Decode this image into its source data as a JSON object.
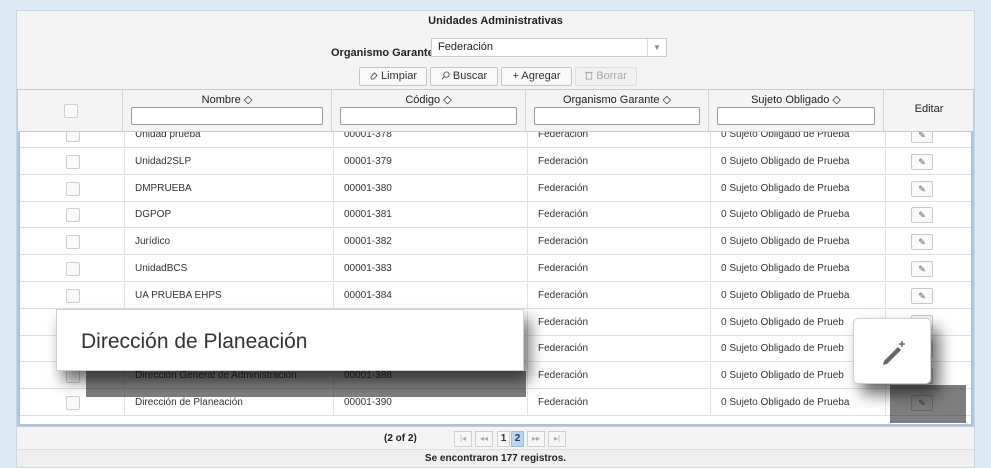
{
  "panel": {
    "title": "Unidades Administrativas",
    "organismo_label": "Organismo Garante:",
    "organismo_value": "Federación",
    "select_arrow": "▼"
  },
  "toolbar": {
    "limpiar": "Limpiar",
    "buscar": "Buscar",
    "agregar": "Agregar",
    "borrar": "Borrar"
  },
  "grid": {
    "headers": {
      "nombre": "Nombre ◇",
      "codigo": "Código ◇",
      "organismo": "Organismo Garante ◇",
      "sujeto": "Sujeto Obligado ◇",
      "editar": "Editar"
    },
    "rows": [
      {
        "nombre": "Unidad  prueba",
        "codigo": "00001-378",
        "organismo": "Federación",
        "sujeto": "0 Sujeto Obligado de Prueba"
      },
      {
        "nombre": "Unidad2SLP",
        "codigo": "00001-379",
        "organismo": "Federación",
        "sujeto": "0 Sujeto Obligado de Prueba"
      },
      {
        "nombre": "DMPRUEBA",
        "codigo": "00001-380",
        "organismo": "Federación",
        "sujeto": "0 Sujeto Obligado de Prueba"
      },
      {
        "nombre": "DGPOP",
        "codigo": "00001-381",
        "organismo": "Federación",
        "sujeto": "0 Sujeto Obligado de Prueba"
      },
      {
        "nombre": "Jurídico",
        "codigo": "00001-382",
        "organismo": "Federación",
        "sujeto": "0 Sujeto Obligado de Prueba"
      },
      {
        "nombre": "UnidadBCS",
        "codigo": "00001-383",
        "organismo": "Federación",
        "sujeto": "0 Sujeto Obligado de Prueba"
      },
      {
        "nombre": "UA PRUEBA EHPS",
        "codigo": "00001-384",
        "organismo": "Federación",
        "sujeto": "0 Sujeto Obligado de Prueba"
      },
      {
        "nombre": "",
        "codigo": "",
        "organismo": "Federación",
        "sujeto": "0 Sujeto Obligado de Prueb"
      },
      {
        "nombre": "",
        "codigo": "",
        "organismo": "Federación",
        "sujeto": "0 Sujeto Obligado de Prueb"
      },
      {
        "nombre": "Dirección General de Administración",
        "codigo": "00001-388",
        "organismo": "Federación",
        "sujeto": "0 Sujeto Obligado de Prueb"
      },
      {
        "nombre": "Dirección de Planeación",
        "codigo": "00001-390",
        "organismo": "Federación",
        "sujeto": "0 Sujeto Obligado de Prueba"
      }
    ]
  },
  "pager": {
    "info": "(2 of 2)",
    "first": "|◂",
    "prev": "◂◂",
    "page1": "1",
    "page2": "2",
    "next": "▸▸",
    "last": "▸|",
    "current_page": 2
  },
  "footer": "Se encontraron 177 registros.",
  "zoom": {
    "name": "Dirección de Planeación"
  },
  "icons": {
    "limpiar": "eraser-icon",
    "buscar": "search-icon",
    "agregar": "plus-icon",
    "borrar": "trash-icon",
    "editar": "pencil-icon"
  },
  "colors": {
    "background": "#dde9f3",
    "selection_border": "#a5c3e8",
    "active_page": "#bcd4ec"
  }
}
